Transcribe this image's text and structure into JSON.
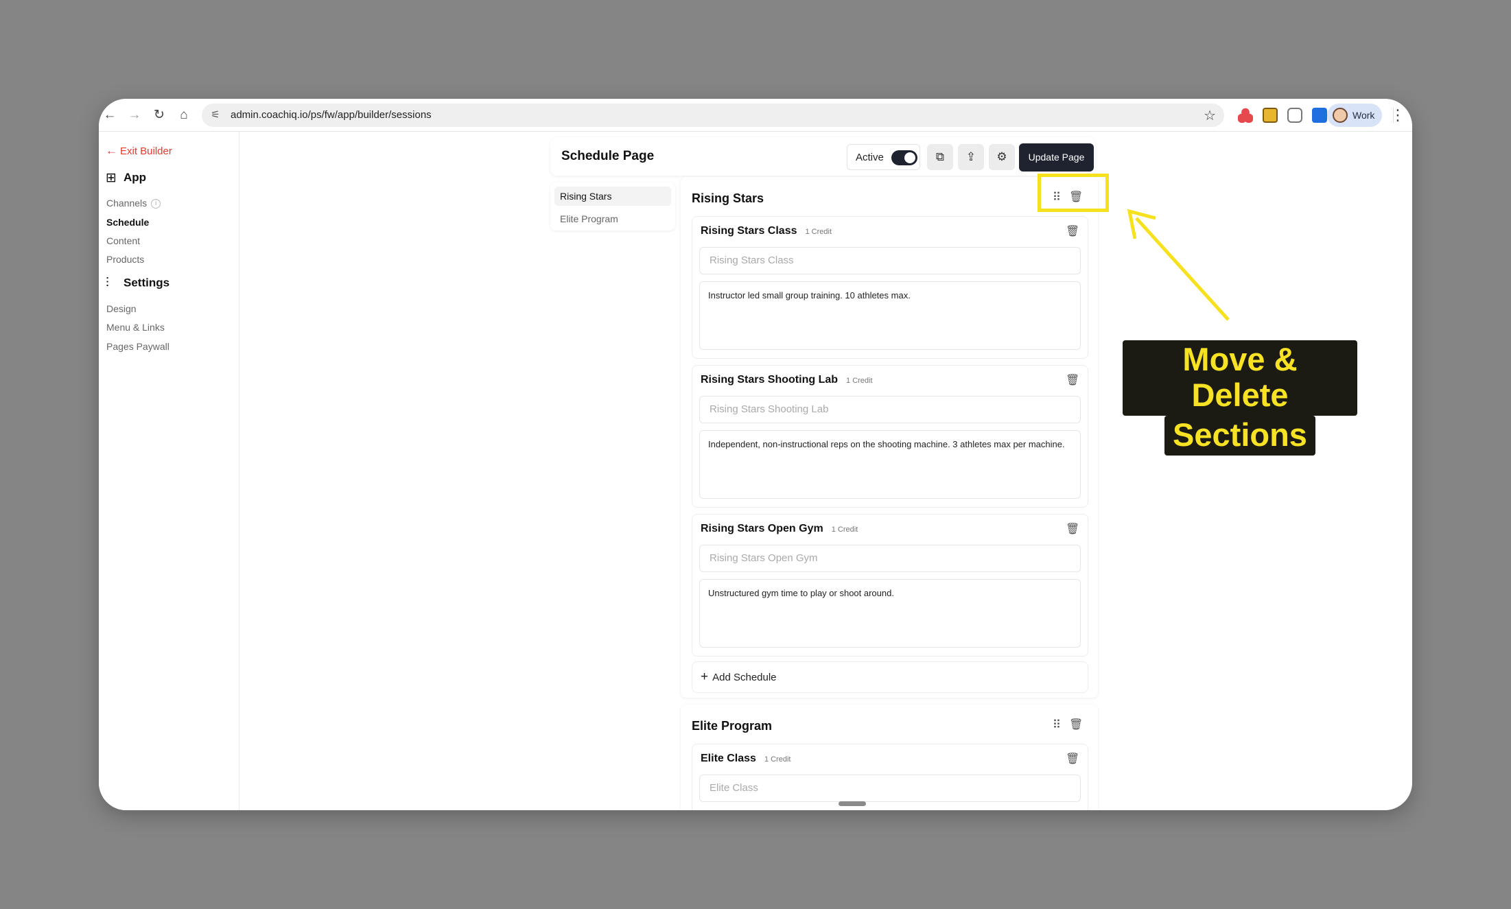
{
  "browser": {
    "url": "admin.coachiq.io/ps/fw/app/builder/sessions",
    "profile_label": "Work"
  },
  "sidebar": {
    "exit_label": "Exit Builder",
    "app_heading": "App",
    "app_items": [
      "Channels",
      "Schedule",
      "Content",
      "Products"
    ],
    "settings_heading": "Settings",
    "settings_items": [
      "Design",
      "Menu & Links",
      "Pages Paywall"
    ]
  },
  "header": {
    "title": "Schedule Page",
    "active_label": "Active",
    "active_on": true,
    "update_label": "Update Page"
  },
  "tabs": [
    "Rising Stars",
    "Elite Program"
  ],
  "sections": [
    {
      "title": "Rising Stars",
      "items": [
        {
          "name": "Rising Stars Class",
          "credit": "1 Credit",
          "placeholder": "Rising Stars Class",
          "description": "Instructor led small group training. 10 athletes max."
        },
        {
          "name": "Rising Stars Shooting Lab",
          "credit": "1 Credit",
          "placeholder": "Rising Stars Shooting Lab",
          "description": "Independent, non-instructional reps on the shooting machine. 3 athletes max per machine."
        },
        {
          "name": "Rising Stars Open Gym",
          "credit": "1 Credit",
          "placeholder": "Rising Stars Open Gym",
          "description": "Unstructured gym time to play or shoot around."
        }
      ],
      "add_label": "Add Schedule"
    },
    {
      "title": "Elite Program",
      "items": [
        {
          "name": "Elite Class",
          "credit": "1 Credit",
          "placeholder": "Elite Class"
        }
      ]
    }
  ],
  "annotation": {
    "line1": "Move & Delete",
    "line2": "Sections",
    "color": "#f6e11f"
  }
}
